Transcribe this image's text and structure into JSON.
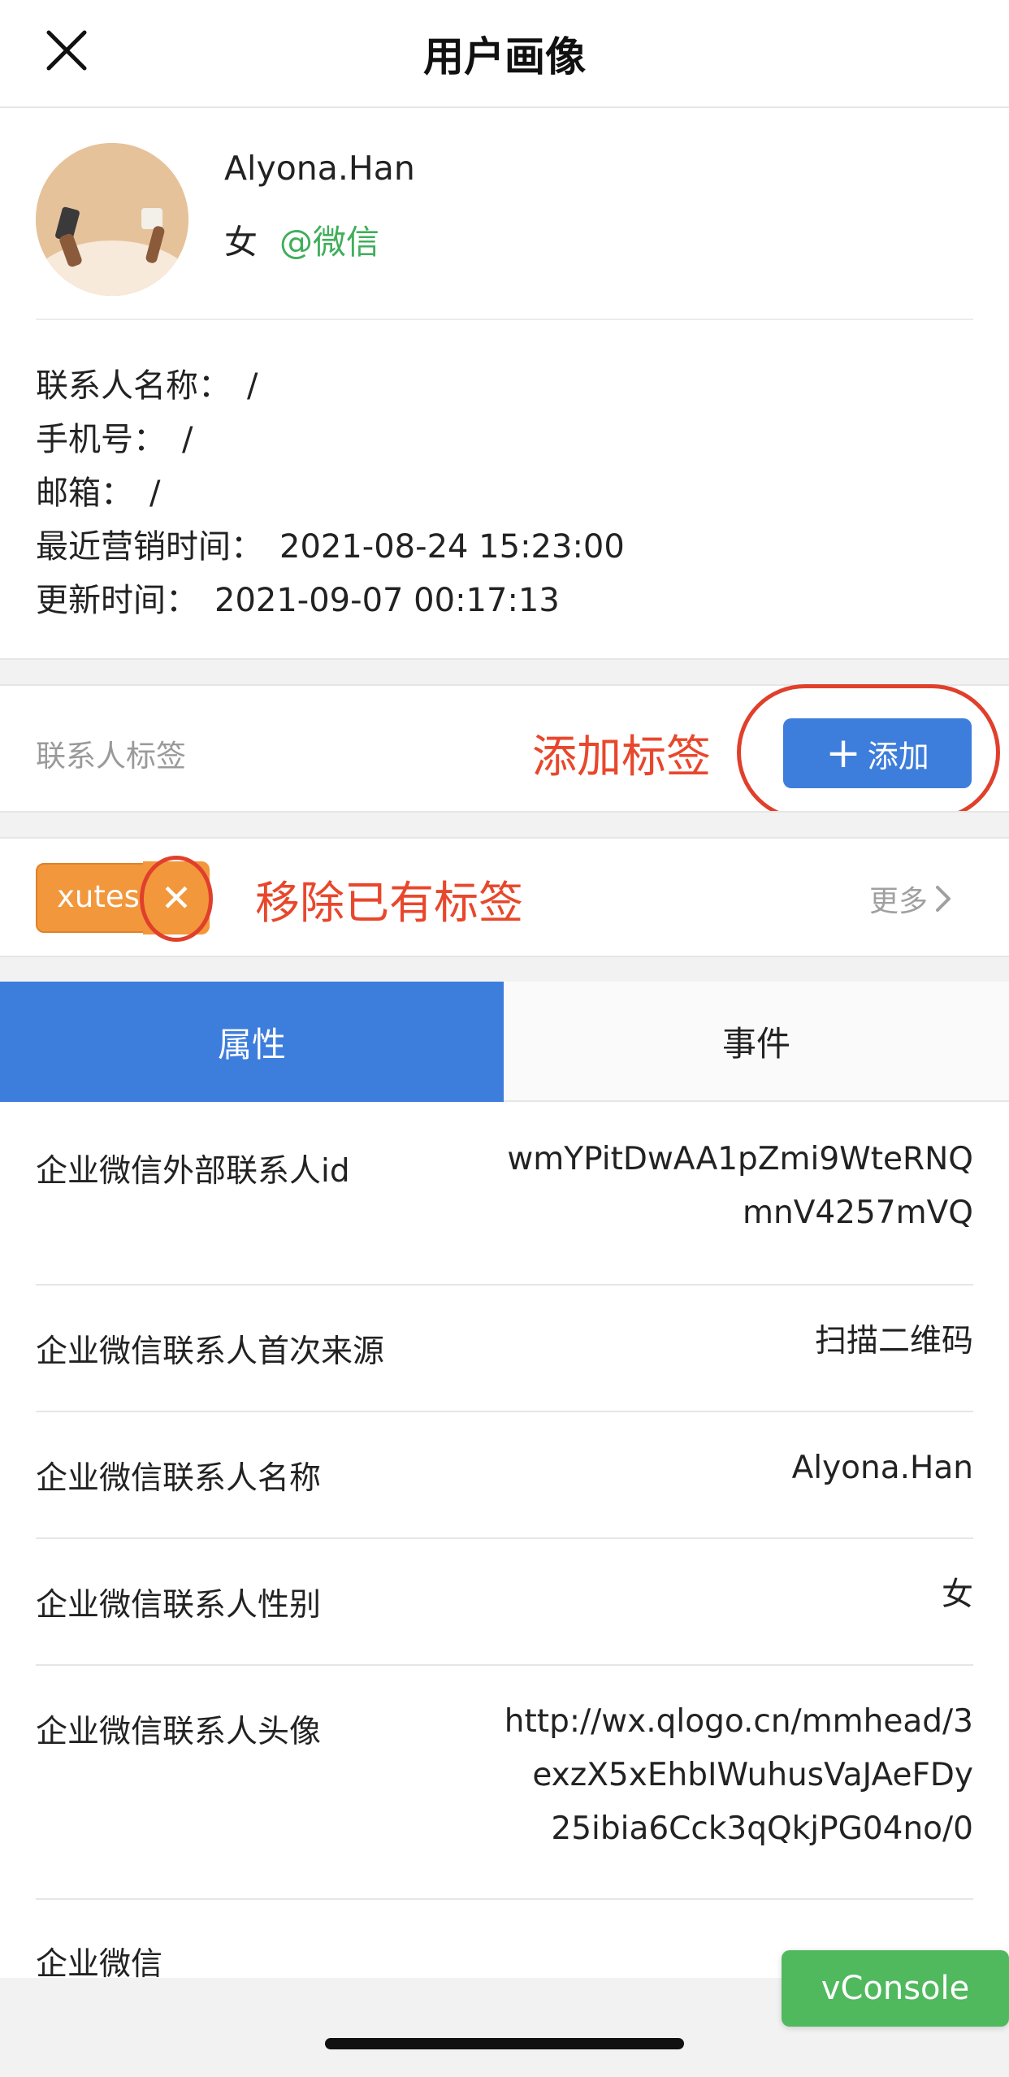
{
  "header": {
    "title": "用户画像",
    "close_icon": "close-icon"
  },
  "profile": {
    "name": "Alyona.Han",
    "gender": "女",
    "source": "@微信",
    "source_color": "#3fae5a"
  },
  "info": [
    {
      "label": "联系人名称：",
      "value": "/"
    },
    {
      "label": "手机号：",
      "value": "/"
    },
    {
      "label": "邮箱：",
      "value": "/"
    },
    {
      "label": "最近营销时间：",
      "value": "2021-08-24 15:23:00"
    },
    {
      "label": "更新时间：",
      "value": "2021-09-07 00:17:13"
    }
  ],
  "tags": {
    "label": "联系人标签",
    "add_annotation": "添加标签",
    "add_button": "添加",
    "chip_text": "xutest",
    "remove_icon": "✕",
    "remove_annotation": "移除已有标签",
    "more": "更多",
    "annotation_color": "#e8472c",
    "chip_color": "#f2973c"
  },
  "tabs": [
    {
      "label": "属性",
      "active": true
    },
    {
      "label": "事件",
      "active": false
    }
  ],
  "accent_color": "#3d7ddc",
  "attributes": [
    {
      "key": "企业微信外部联系人id",
      "value": "wmYPitDwAA1pZmi9WteRNQ\nmnV4257mVQ"
    },
    {
      "key": "企业微信联系人首次来源",
      "value": "扫描二维码"
    },
    {
      "key": "企业微信联系人名称",
      "value": "Alyona.Han"
    },
    {
      "key": "企业微信联系人性别",
      "value": "女"
    },
    {
      "key": "企业微信联系人头像",
      "value": "http://wx.qlogo.cn/mmhead/3\nexzX5xEhbIWuhusVaJAeFDy\n25ibia6Cck3qQkjPG04no/0"
    },
    {
      "key": "企业微信",
      "value": ""
    }
  ],
  "vconsole": "vConsole"
}
